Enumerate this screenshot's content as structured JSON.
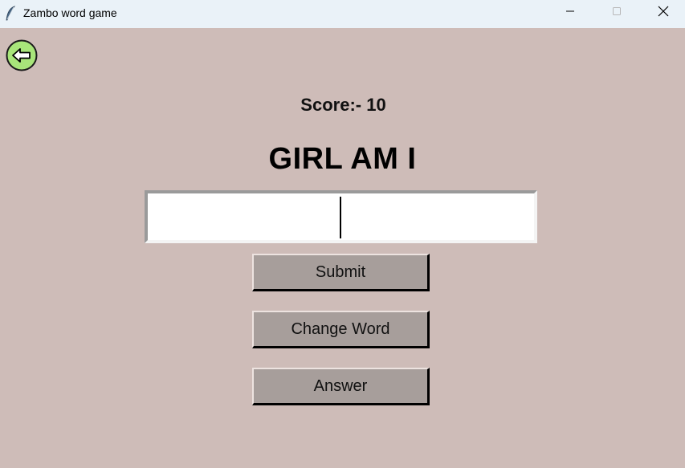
{
  "window": {
    "title": "Zambo word game",
    "icons": [
      "feather-icon",
      "minimize-icon",
      "maximize-icon",
      "close-icon"
    ]
  },
  "back_button": {
    "icon": "arrow-left-icon",
    "color": "#a8e57a"
  },
  "game": {
    "score_text": "Score:- 10",
    "scrambled_word": "GIRL AM I",
    "answer_value": ""
  },
  "buttons": {
    "submit_label": "Submit",
    "change_word_label": "Change Word",
    "answer_label": "Answer"
  },
  "colors": {
    "background": "#ceBCB8",
    "titlebar": "#eaf2f8",
    "button_face": "#a79e9b"
  }
}
